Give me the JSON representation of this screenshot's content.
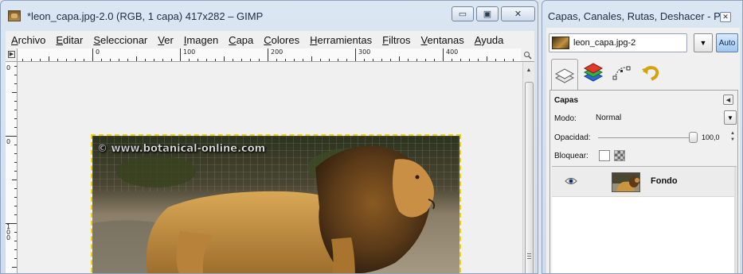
{
  "gimp_window": {
    "title": "*leon_capa.jpg-2.0 (RGB, 1 capa) 417x282 – GIMP",
    "buttons": {
      "minimize": "▭",
      "maximize": "▣",
      "close": "✕"
    },
    "menu": [
      "Archivo",
      "Editar",
      "Seleccionar",
      "Ver",
      "Imagen",
      "Capa",
      "Colores",
      "Herramientas",
      "Filtros",
      "Ventanas",
      "Ayuda"
    ],
    "ruler": {
      "nav_glyph": "▶",
      "h_labels": [
        "0",
        "100",
        "200",
        "300",
        "400"
      ],
      "v_labels": [
        "0",
        "0",
        "100"
      ]
    },
    "canvas": {
      "watermark": "© www.botanical-online.com"
    }
  },
  "dock_window": {
    "title": "Capas, Canales, Rutas, Deshacer - P...",
    "close": "✕",
    "image_selector": {
      "value": "leon_capa.jpg-2"
    },
    "auto_button": "Auto",
    "layers_panel": {
      "title": "Capas",
      "mode_label": "Modo:",
      "mode_value": "Normal",
      "opacity_label": "Opacidad:",
      "opacity_value": "100,0",
      "opacity": 100,
      "lock_label": "Bloquear:",
      "layers": [
        {
          "name": "Fondo",
          "visible": true
        }
      ]
    }
  },
  "colors": {
    "selection_marching_ants": "#f1d300",
    "title_bar": "#cfdcec",
    "auto_button": "#9ec6ef"
  }
}
